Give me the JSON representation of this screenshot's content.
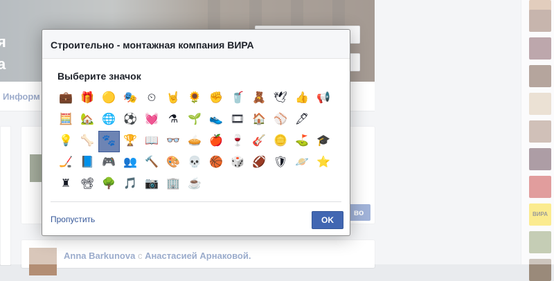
{
  "background": {
    "cover_title_line1": "я",
    "cover_title_line2": "а",
    "tab_label": "Информ",
    "post_button_partial": "во",
    "story": {
      "author": "Anna Barkunova",
      "connector": "с",
      "tagged": "Анастасией Арнаковой."
    }
  },
  "dialog": {
    "title": "Строительно - монтажная компания ВИРА",
    "subtitle": "Выберите значок",
    "skip_label": "Пропустить",
    "ok_label": "OK",
    "selected_index": 27,
    "icons": [
      {
        "name": "briefcase-icon",
        "glyph": "💼"
      },
      {
        "name": "gift-icon",
        "glyph": "🎁"
      },
      {
        "name": "coin-icon",
        "glyph": "🟡"
      },
      {
        "name": "theater-masks-icon",
        "glyph": "🎭"
      },
      {
        "name": "clock-icon",
        "glyph": "⏲"
      },
      {
        "name": "rock-hand-icon",
        "glyph": "🤘"
      },
      {
        "name": "sunflower-icon",
        "glyph": "🌻"
      },
      {
        "name": "fist-icon",
        "glyph": "✊"
      },
      {
        "name": "red-cup-icon",
        "glyph": "🥤"
      },
      {
        "name": "teddy-bear-icon",
        "glyph": "🧸"
      },
      {
        "name": "dove-icon",
        "glyph": "🕊"
      },
      {
        "name": "thumbs-up-icon",
        "glyph": "👍"
      },
      {
        "name": "megaphone-icon",
        "glyph": "📢"
      },
      {
        "name": "calculator-icon",
        "glyph": "🧮"
      },
      {
        "name": "house-icon",
        "glyph": "🏡"
      },
      {
        "name": "globe-icon",
        "glyph": "🌐"
      },
      {
        "name": "soccer-ball-icon",
        "glyph": "⚽"
      },
      {
        "name": "heartbeat-icon",
        "glyph": "💓"
      },
      {
        "name": "flask-icon",
        "glyph": "⚗"
      },
      {
        "name": "plant-icon",
        "glyph": "🌱"
      },
      {
        "name": "sneaker-icon",
        "glyph": "👟"
      },
      {
        "name": "film-icon",
        "glyph": "🎞"
      },
      {
        "name": "home-icon",
        "glyph": "🏠"
      },
      {
        "name": "baseball-icon",
        "glyph": "⚾"
      },
      {
        "name": "quill-icon",
        "glyph": "🖋"
      },
      {
        "name": "lightbulb-icon",
        "glyph": "💡"
      },
      {
        "name": "bone-icon",
        "glyph": "🦴"
      },
      {
        "name": "paw-icon",
        "glyph": "🐾"
      },
      {
        "name": "trophy-icon",
        "glyph": "🏆"
      },
      {
        "name": "book-icon",
        "glyph": "📖"
      },
      {
        "name": "glasses-icon",
        "glyph": "👓"
      },
      {
        "name": "pie-chart-icon",
        "glyph": "🥧"
      },
      {
        "name": "apple-icon",
        "glyph": "🍎"
      },
      {
        "name": "wine-glass-icon",
        "glyph": "🍷"
      },
      {
        "name": "guitar-icon",
        "glyph": "🎸"
      },
      {
        "name": "gold-coin-icon",
        "glyph": "🪙"
      },
      {
        "name": "golf-icon",
        "glyph": "⛳"
      },
      {
        "name": "graduation-cap-icon",
        "glyph": "🎓"
      },
      {
        "name": "hockey-puck-icon",
        "glyph": "🏒"
      },
      {
        "name": "notepad-icon",
        "glyph": "📘"
      },
      {
        "name": "gamepad-icon",
        "glyph": "🎮"
      },
      {
        "name": "contacts-icon",
        "glyph": "👥"
      },
      {
        "name": "gavel-icon",
        "glyph": "🔨"
      },
      {
        "name": "palette-icon",
        "glyph": "🎨"
      },
      {
        "name": "skull-icon",
        "glyph": "💀"
      },
      {
        "name": "basketball-icon",
        "glyph": "🏀"
      },
      {
        "name": "dice-icon",
        "glyph": "🎲"
      },
      {
        "name": "football-icon",
        "glyph": "🏈"
      },
      {
        "name": "shield-icon",
        "glyph": "🛡"
      },
      {
        "name": "planet-icon",
        "glyph": "🪐"
      },
      {
        "name": "star-badge-icon",
        "glyph": "⭐"
      },
      {
        "name": "chess-rook-icon",
        "glyph": "♜"
      },
      {
        "name": "video-icon",
        "glyph": "📽"
      },
      {
        "name": "tree-icon",
        "glyph": "🌳"
      },
      {
        "name": "music-notes-icon",
        "glyph": "🎵"
      },
      {
        "name": "camera-icon",
        "glyph": "📷"
      },
      {
        "name": "building-icon",
        "glyph": "🏢"
      },
      {
        "name": "mug-icon",
        "glyph": "☕"
      },
      {
        "name": "horse-icon",
        "glyph": "🐎"
      }
    ]
  }
}
